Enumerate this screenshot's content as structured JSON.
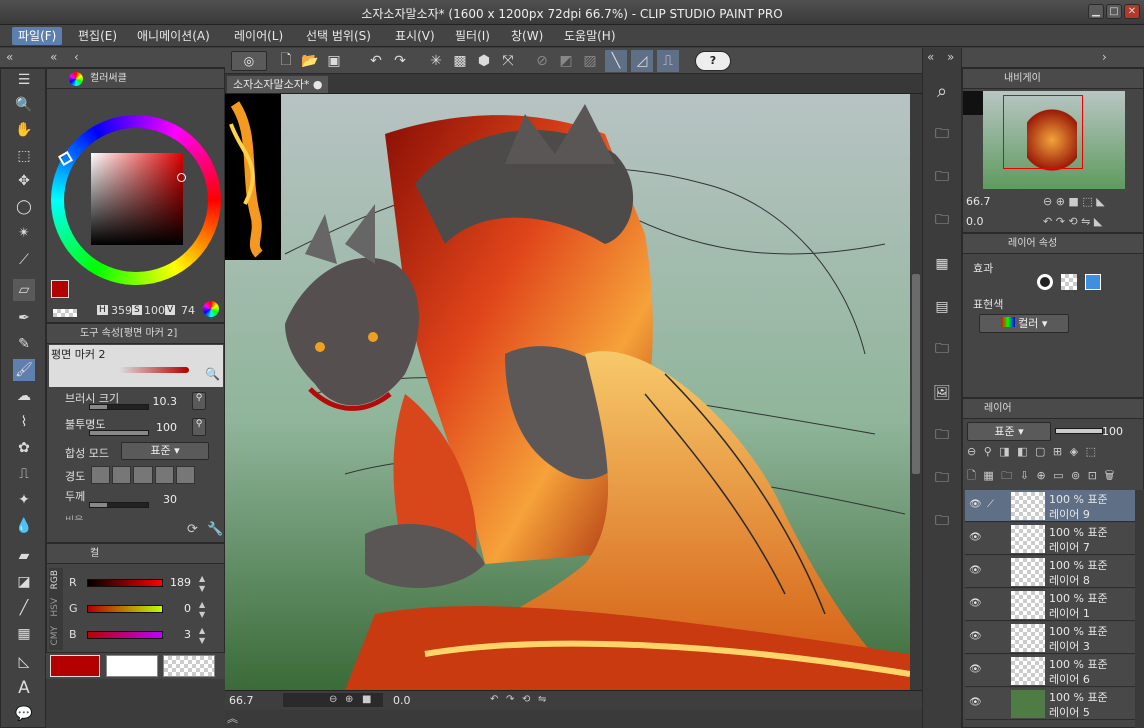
{
  "window": {
    "title": "소자소자말소자* (1600 x 1200px 72dpi 66.7%)  - CLIP STUDIO PAINT PRO"
  },
  "menu": [
    {
      "label": "파일(F)",
      "active": true
    },
    {
      "label": "편집(E)"
    },
    {
      "label": "애니메이션(A)"
    },
    {
      "label": "레이어(L)"
    },
    {
      "label": "선택 범위(S)"
    },
    {
      "label": "표시(V)"
    },
    {
      "label": "필터(I)"
    },
    {
      "label": "창(W)"
    },
    {
      "label": "도움말(H)"
    }
  ],
  "color_panel": {
    "tab_label": "컬러써클",
    "h_label": "H",
    "h": "359",
    "s_label": "S",
    "s": "100",
    "v_label": "V",
    "v": "74",
    "main_color": "#b30000",
    "sub_color": "#ffffff"
  },
  "tool_property": {
    "tab_label": "도구 속성[평면 마커 2]",
    "preset_name": "평면 마커 2",
    "brush_size_label": "브러시 크기",
    "brush_size": "10.3",
    "opacity_label": "불투명도",
    "opacity": "100",
    "blend_label": "합성 모드",
    "blend_value": "표준",
    "hardness_label": "경도",
    "thickness_label": "두께",
    "thickness": "30",
    "cut_label": "비율"
  },
  "color_slider": {
    "tab_label": "컬",
    "mode_rgb": "RGB",
    "mode_hsv": "HSV",
    "mode_cmy": "CMY",
    "r_label": "R",
    "r": "189",
    "g_label": "G",
    "g": "0",
    "b_label": "B",
    "b": "3"
  },
  "canvas": {
    "tab_label": "소자소자말소자*",
    "zoom": "66.7",
    "angle": "0.0"
  },
  "navigator": {
    "tab_label": "내비게이",
    "zoom": "66.7",
    "angle": "0.0"
  },
  "layer_property": {
    "tab_label": "레이어 속성",
    "effect_label": "효과",
    "expression_label": "표현색",
    "expression_value": "컬러"
  },
  "layers_panel": {
    "tab_label": "레이어",
    "blend_mode": "표준",
    "opacity": "100",
    "layers": [
      {
        "mode": "100 % 표준",
        "name": "레이어 9",
        "selected": true
      },
      {
        "mode": "100 % 표준",
        "name": "레이어 7"
      },
      {
        "mode": "100 % 표준",
        "name": "레이어 8"
      },
      {
        "mode": "100 % 표준",
        "name": "레이어 1"
      },
      {
        "mode": "100 % 표준",
        "name": "레이어 3"
      },
      {
        "mode": "100 % 표준",
        "name": "레이어 6"
      },
      {
        "mode": "100 % 표준",
        "name": "레이어 5"
      }
    ]
  }
}
